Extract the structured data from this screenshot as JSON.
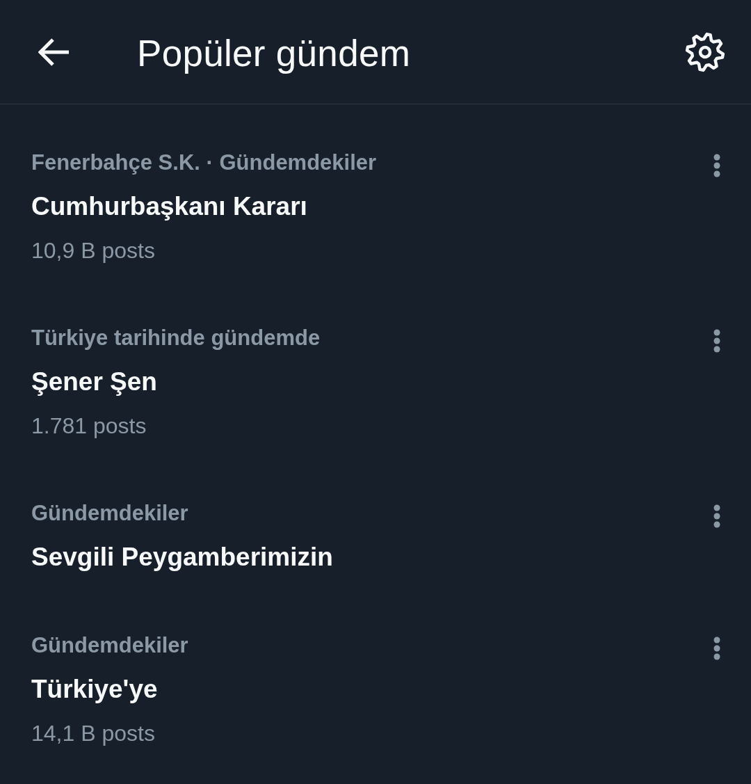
{
  "header": {
    "title": "Popüler gündem"
  },
  "trends": [
    {
      "context": "Fenerbahçe S.K. · Gündemdekiler",
      "name": "Cumhurbaşkanı Kararı",
      "posts": "10,9 B posts"
    },
    {
      "context": "Türkiye tarihinde gündemde",
      "name": "Şener Şen",
      "posts": "1.781 posts"
    },
    {
      "context": "Gündemdekiler",
      "name": "Sevgili Peygamberimizin"
    },
    {
      "context": "Gündemdekiler",
      "name": "Türkiye'ye",
      "posts": "14,1 B posts"
    }
  ]
}
